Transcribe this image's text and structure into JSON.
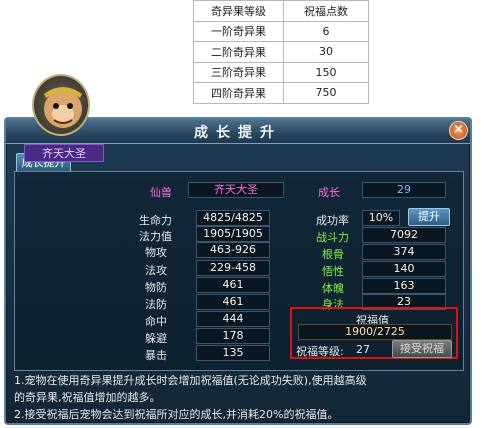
{
  "ref_table": {
    "headers": [
      "奇异果等级",
      "祝福点数"
    ],
    "rows": [
      [
        "一阶奇异果",
        "6"
      ],
      [
        "二阶奇异果",
        "30"
      ],
      [
        "三阶奇异果",
        "150"
      ],
      [
        "四阶奇异果",
        "750"
      ]
    ]
  },
  "window": {
    "title": "成长提升",
    "close_icon": "×",
    "tab_label": "成长提升",
    "pet_name": "齐天大圣",
    "header": {
      "type_label": "仙兽",
      "name_value": "齐天大圣",
      "growth_label": "成长",
      "growth_value": "29"
    },
    "left_stats": [
      {
        "label": "生命力",
        "value": "4825/4825"
      },
      {
        "label": "法力值",
        "value": "1905/1905"
      },
      {
        "label": "物攻",
        "value": "463-926"
      },
      {
        "label": "法攻",
        "value": "229-458"
      },
      {
        "label": "物防",
        "value": "461"
      },
      {
        "label": "法防",
        "value": "461"
      },
      {
        "label": "命中",
        "value": "444"
      },
      {
        "label": "躲避",
        "value": "178"
      },
      {
        "label": "暴击",
        "value": "135"
      }
    ],
    "success_rate": {
      "label": "成功率",
      "value": "10%",
      "button": "提升"
    },
    "right_stats": [
      {
        "label": "战斗力",
        "value": "7092"
      },
      {
        "label": "根骨",
        "value": "374"
      },
      {
        "label": "悟性",
        "value": "140"
      },
      {
        "label": "体魄",
        "value": "163"
      },
      {
        "label": "身法",
        "value": "23"
      }
    ],
    "blessing": {
      "title": "祝福值",
      "value": "1900/2725",
      "level_label": "祝福等级:",
      "level_value": "27",
      "accept_button": "接受祝福"
    },
    "desc": [
      "1.宠物在使用奇异果提升成长时会增加祝福值(无论成功失败),使用越高级",
      "的奇异果,祝福值增加的越多。",
      "2.接受祝福后宠物会达到祝福所对应的成长,并消耗20%的祝福值。"
    ]
  }
}
